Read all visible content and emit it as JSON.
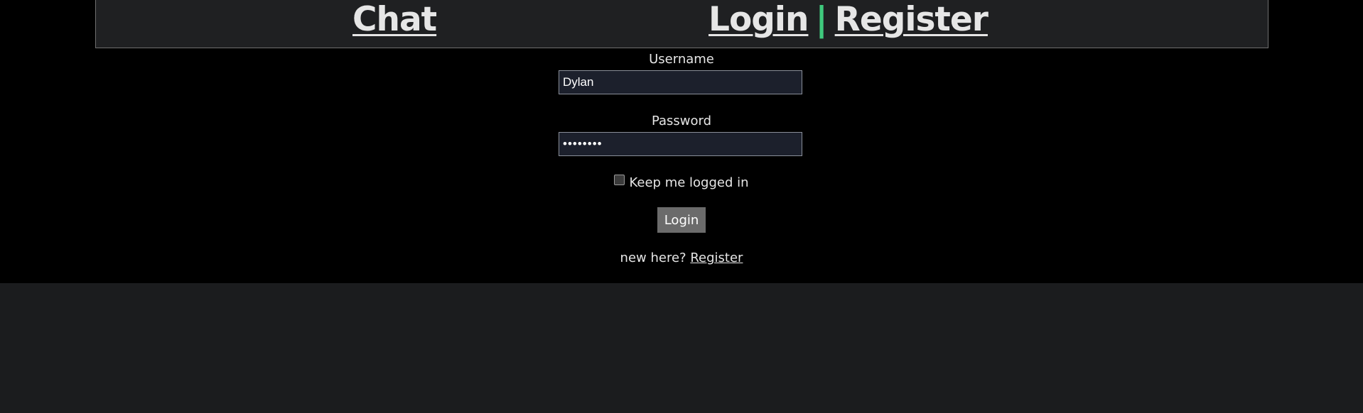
{
  "header": {
    "chat_link": "Chat",
    "login_link": "Login",
    "separator": "|",
    "register_link": "Register"
  },
  "form": {
    "username_label": "Username",
    "username_value": "Dylan",
    "password_label": "Password",
    "password_value": "••••••••",
    "keep_logged_in_label": "Keep me logged in",
    "keep_logged_in_checked": false,
    "login_button": "Login",
    "new_here_text": "new here?",
    "register_link": "Register"
  },
  "colors": {
    "separator_accent": "#3fc97d",
    "page_background": "#000000",
    "outer_background": "#1b1c1e",
    "header_background": "#1f2022"
  }
}
